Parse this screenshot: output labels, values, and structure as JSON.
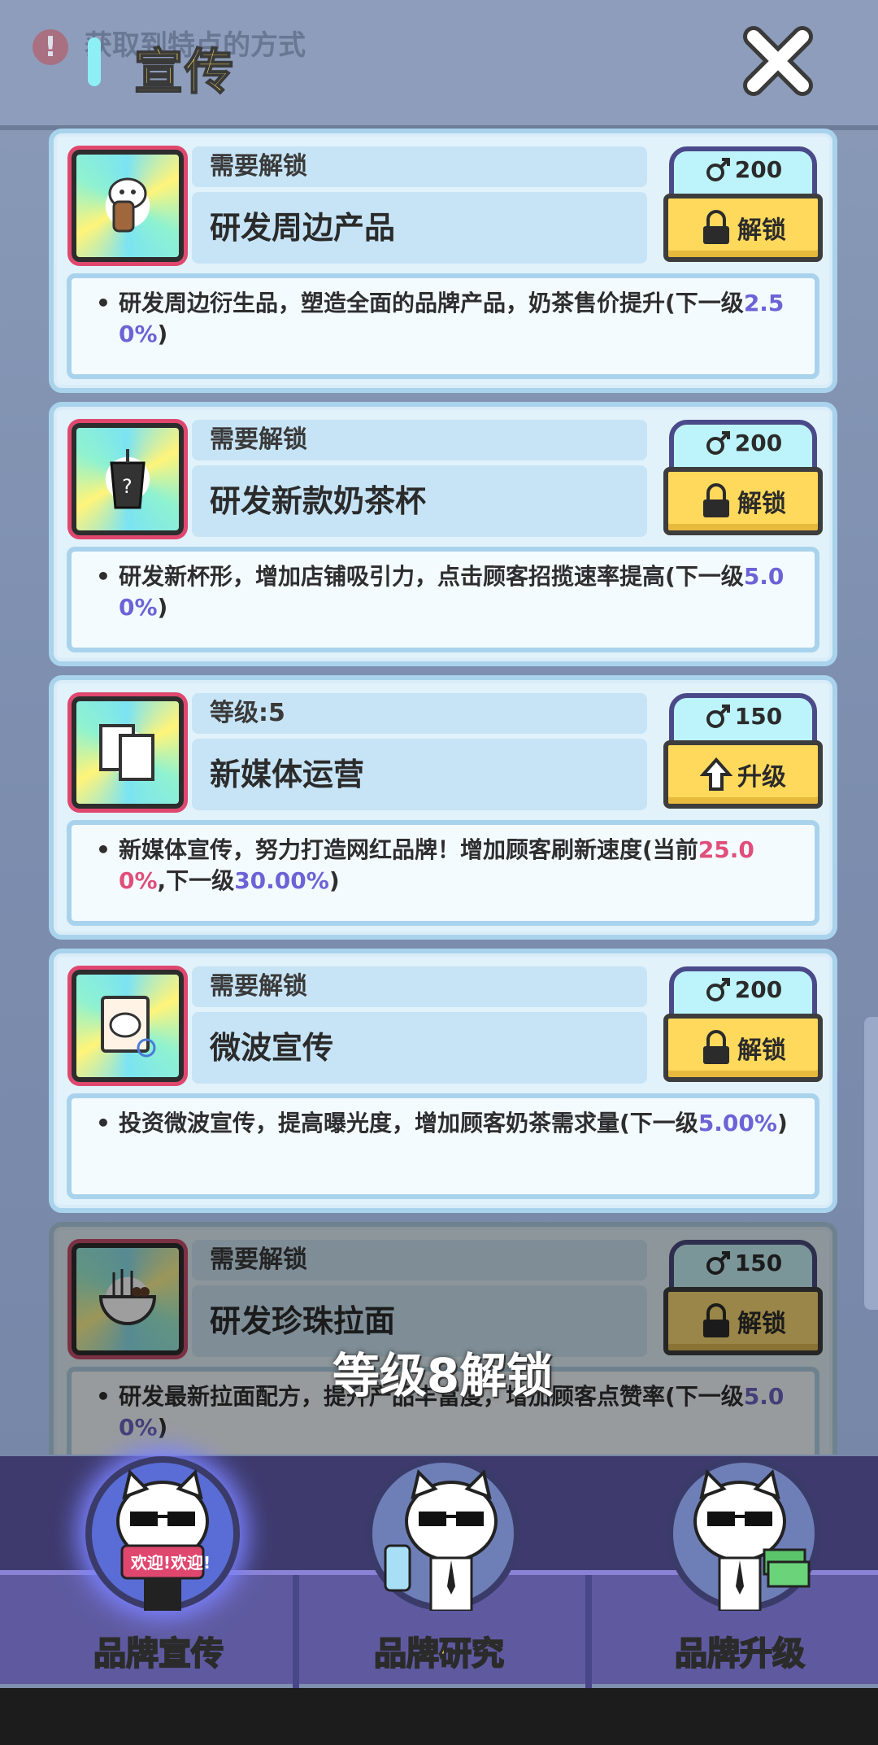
{
  "background": {
    "hint_text": "获取到特点的方式",
    "hint_icon": "!"
  },
  "header": {
    "title": "宣传"
  },
  "cards": [
    {
      "status": "需要解锁",
      "name": "研发周边产品",
      "cost": "200",
      "action": "解锁",
      "action_icon": "lock-icon",
      "desc_prefix": "研发周边衍生品，塑造全面的品牌产品，奶茶售价提升(下一级",
      "desc_value": "2.50%",
      "desc_suffix": ")",
      "icon": "cat-drink-icon"
    },
    {
      "status": "需要解锁",
      "name": "研发新款奶茶杯",
      "cost": "200",
      "action": "解锁",
      "action_icon": "lock-icon",
      "desc_prefix": "研发新杯形，增加店铺吸引力，点击顾客招揽速率提高(下一级",
      "desc_value": "5.00%",
      "desc_suffix": ")",
      "icon": "tea-cup-icon"
    },
    {
      "status": "等级:5",
      "name": "新媒体运营",
      "cost": "150",
      "action": "升级",
      "action_icon": "up-arrow-icon",
      "desc_prefix": "新媒体宣传，努力打造网红品牌！增加顾客刷新速度(当前",
      "desc_current": "25.00%",
      "desc_mid": ",下一级",
      "desc_value": "30.00%",
      "desc_suffix": ")",
      "icon": "documents-icon"
    },
    {
      "status": "需要解锁",
      "name": "微波宣传",
      "cost": "200",
      "action": "解锁",
      "action_icon": "lock-icon",
      "desc_prefix": "投资微波宣传，提高曝光度，增加顾客奶茶需求量(下一级",
      "desc_value": "5.00%",
      "desc_suffix": ")",
      "icon": "social-post-icon"
    },
    {
      "status": "需要解锁",
      "name": "研发珍珠拉面",
      "cost": "150",
      "action": "解锁",
      "action_icon": "lock-icon",
      "desc_prefix": "研发最新拉面配方，提升产品丰富度，增加顾客点赞率(下一级",
      "desc_value": "5.00%",
      "desc_suffix": ")",
      "icon": "noodle-bowl-icon"
    }
  ],
  "lock_overlay": "等级8解锁",
  "nav": [
    {
      "label": "品牌宣传",
      "active": true,
      "sign": "欢迎!欢迎!"
    },
    {
      "label": "品牌研究",
      "active": false
    },
    {
      "label": "品牌升级",
      "active": false
    }
  ],
  "colors": {
    "accent_yellow": "#ffe35c",
    "highlight": "#6d63d6",
    "highlight_red": "#e04e7a"
  }
}
